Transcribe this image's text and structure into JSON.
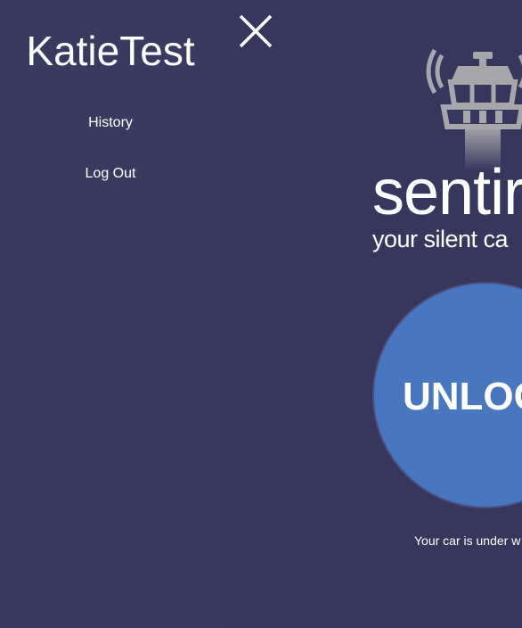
{
  "sidebar": {
    "user_name": "KatieTest",
    "items": [
      {
        "label": "History"
      },
      {
        "label": "Log Out"
      }
    ],
    "close_icon": "close-icon"
  },
  "main": {
    "logo_icon": "control-tower-icon",
    "brand_name": "sentir",
    "tagline": "your silent ca",
    "unlock_button": {
      "label": "UNLOC"
    },
    "status_text": "Your car is under w"
  },
  "colors": {
    "background": "#37365c",
    "sidebar_background": "#393a60",
    "button_blue": "#4877bf",
    "text": "#ffffff",
    "icon_gray": "#a6a6ab"
  }
}
